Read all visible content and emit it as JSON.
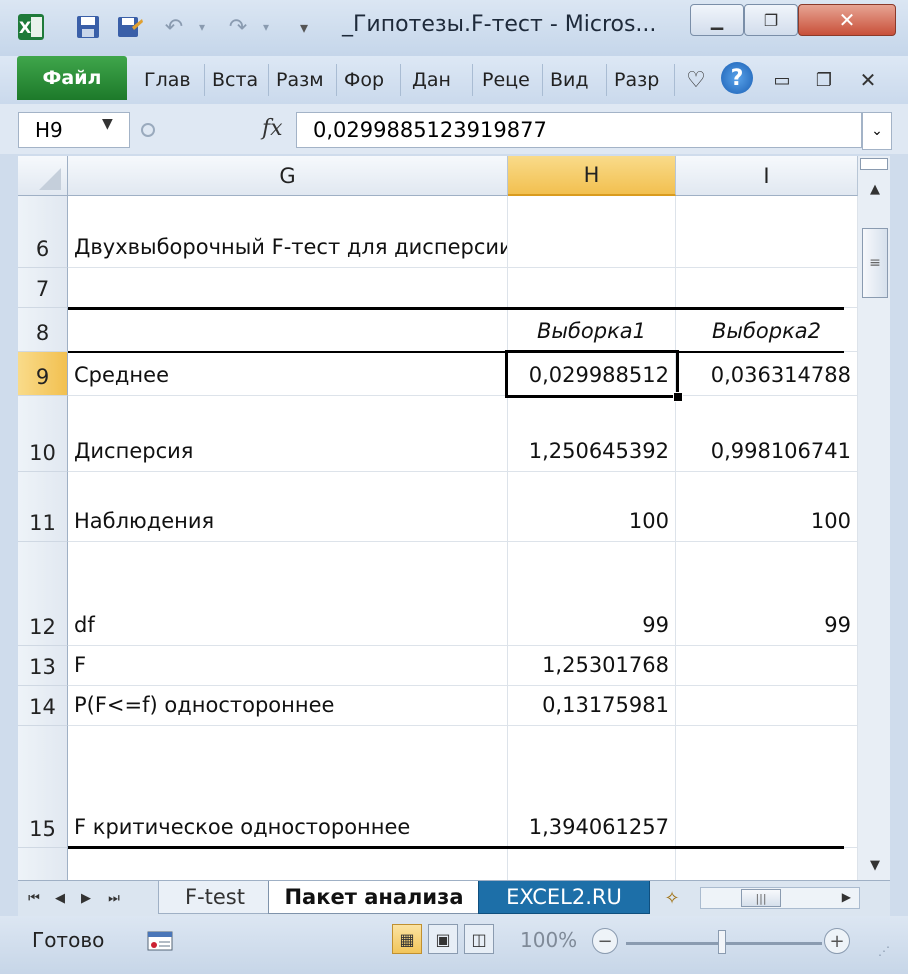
{
  "titlebar": {
    "title": "_Гипотезы.F-тест  -  Micros...",
    "app_icon": "excel-icon",
    "quick_access": [
      "save-icon",
      "save-as-icon",
      "undo-icon",
      "redo-icon",
      "customize-icon"
    ],
    "window_controls": [
      "minimize",
      "restore",
      "close"
    ]
  },
  "ribbon": {
    "file_tab": "Файл",
    "tabs": [
      "Глав",
      "Вста",
      "Разм",
      "Фор",
      "Дан",
      "Реце",
      "Вид",
      "Разр"
    ],
    "help": "?"
  },
  "formula_bar": {
    "name_box": "H9",
    "fx": "fx",
    "value": "0,0299885123919877"
  },
  "sheet": {
    "columns": [
      "G",
      "H",
      "I"
    ],
    "selected_column": "H",
    "selected_row": "9",
    "rows": [
      {
        "num": "6",
        "g": "Двухвыборочный F-тест для дисперсии",
        "h": "",
        "i": ""
      },
      {
        "num": "7",
        "g": "",
        "h": "",
        "i": ""
      },
      {
        "num": "8",
        "g": "",
        "h": "Выборка1",
        "i": "Выборка2"
      },
      {
        "num": "9",
        "g": "Среднее",
        "h": "0,029988512",
        "i": "0,036314788"
      },
      {
        "num": "10",
        "g": "Дисперсия",
        "h": "1,250645392",
        "i": "0,998106741"
      },
      {
        "num": "11",
        "g": "Наблюдения",
        "h": "100",
        "i": "100"
      },
      {
        "num": "12",
        "g": "df",
        "h": "99",
        "i": "99"
      },
      {
        "num": "13",
        "g": "F",
        "h": "1,25301768",
        "i": ""
      },
      {
        "num": "14",
        "g": "P(F<=f) одностороннее",
        "h": "0,13175981",
        "i": ""
      },
      {
        "num": "15",
        "g": "F критическое одностороннее",
        "h": "1,394061257",
        "i": ""
      }
    ]
  },
  "sheet_tabs": {
    "tabs": [
      "F-test",
      "Пакет анализа",
      "EXCEL2.RU"
    ],
    "active": "Пакет анализа"
  },
  "status_bar": {
    "ready": "Готово",
    "zoom": "100%",
    "zoom_minus": "−",
    "zoom_plus": "+"
  },
  "colors": {
    "selected_header": "#f2c050",
    "file_tab": "#2e8f3a",
    "excel_tab": "#1d6fa8"
  }
}
